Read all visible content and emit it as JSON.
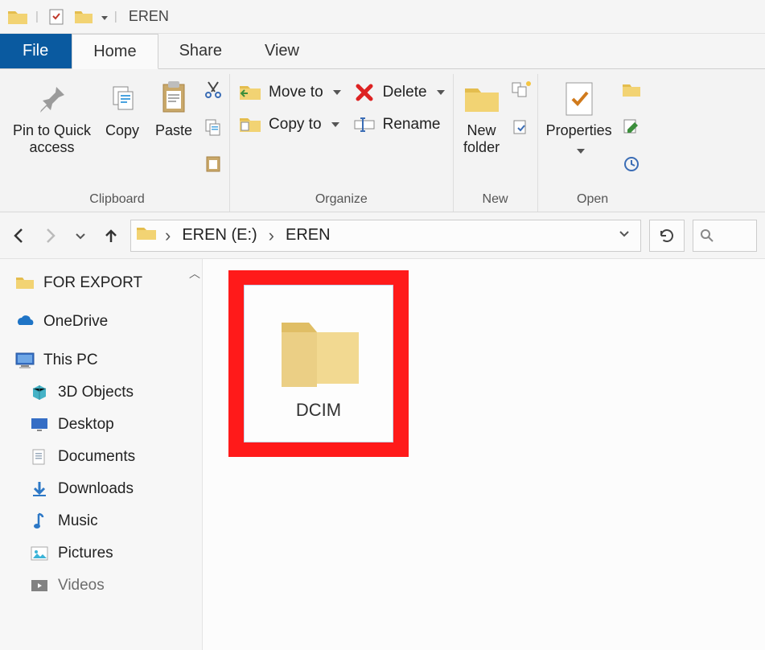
{
  "window": {
    "title": "EREN"
  },
  "tabs": {
    "file": "File",
    "home": "Home",
    "share": "Share",
    "view": "View"
  },
  "ribbon": {
    "pin": "Pin to Quick\naccess",
    "copy": "Copy",
    "paste": "Paste",
    "clipboard_label": "Clipboard",
    "move_to": "Move to",
    "copy_to": "Copy to",
    "delete": "Delete",
    "rename": "Rename",
    "organize_label": "Organize",
    "new_folder": "New\nfolder",
    "new_label": "New",
    "properties": "Properties",
    "open_label": "Open"
  },
  "breadcrumb": {
    "drive": "EREN (E:)",
    "folder": "EREN"
  },
  "sidebar": {
    "for_export": "FOR EXPORT",
    "onedrive": "OneDrive",
    "this_pc": "This PC",
    "objects3d": "3D Objects",
    "desktop": "Desktop",
    "documents": "Documents",
    "downloads": "Downloads",
    "music": "Music",
    "pictures": "Pictures",
    "videos": "Videos"
  },
  "content": {
    "item1": "DCIM"
  }
}
